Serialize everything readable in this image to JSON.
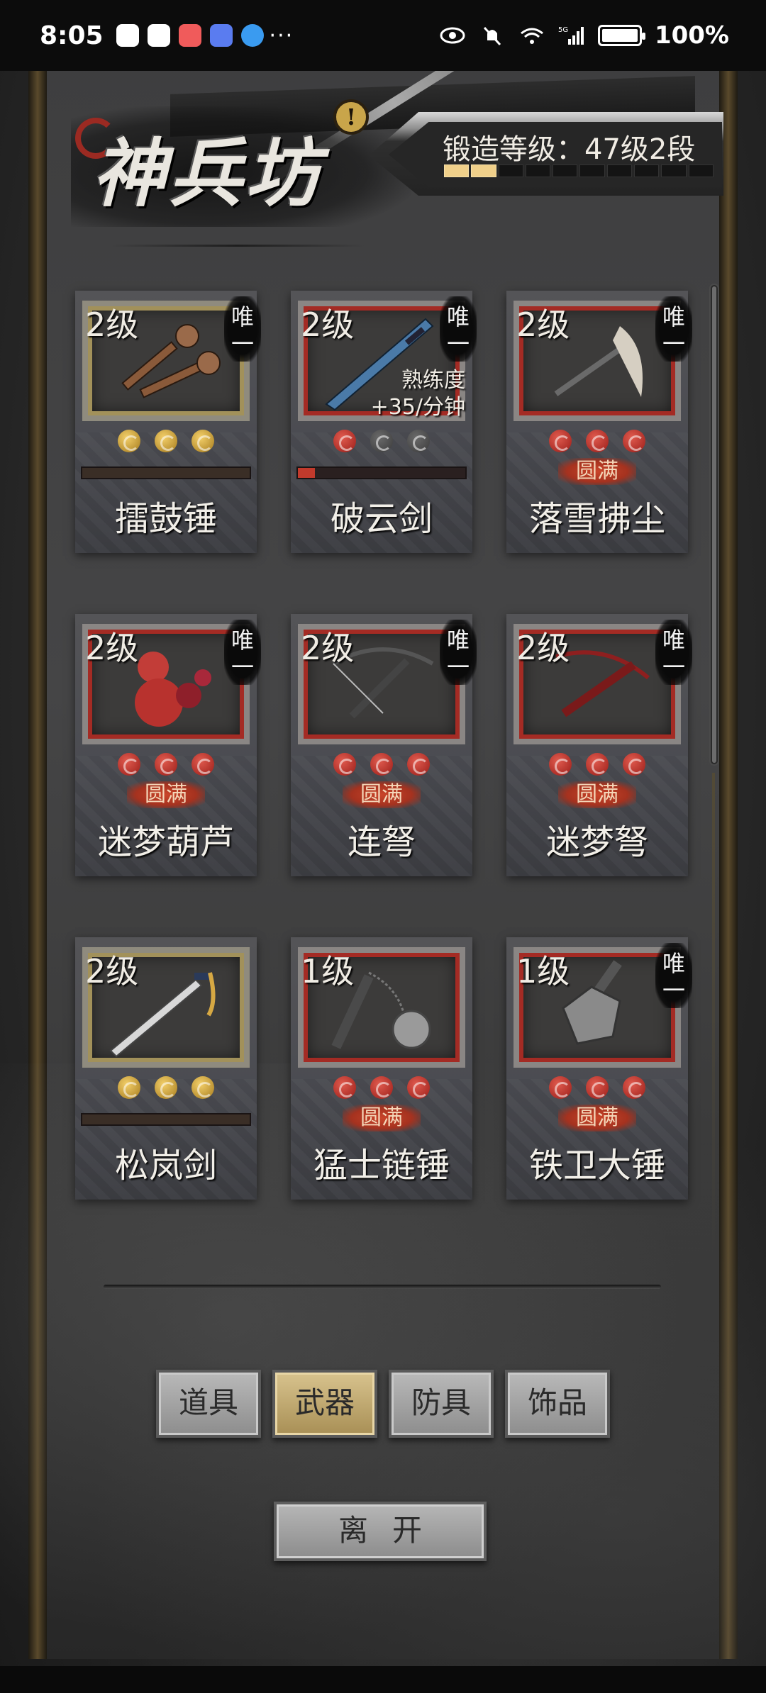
{
  "status_bar": {
    "time": "8:05",
    "more": "···",
    "battery_pct": "100%",
    "network": "5G"
  },
  "header": {
    "title": "神兵坊",
    "info_icon": "!",
    "forge_label": "锻造等级：47级2段",
    "forge_progress": {
      "filled": 2,
      "total": 10
    }
  },
  "weapons": [
    {
      "level": "2级",
      "unique": "唯一",
      "name": "擂鼓锤",
      "gems": [
        "gold",
        "gold",
        "gold"
      ],
      "frame": "gold",
      "status": "bar",
      "bar_fill": 0.0,
      "icon": "twin-hammers-icon"
    },
    {
      "level": "2级",
      "unique": "唯一",
      "name": "破云剑",
      "gems": [
        "red",
        "grey",
        "grey"
      ],
      "frame": "red",
      "status": "bar",
      "bar_fill": 0.1,
      "mastery": "熟练度",
      "rate": "+35/分钟",
      "icon": "blue-sword-icon"
    },
    {
      "level": "2级",
      "unique": "唯一",
      "name": "落雪拂尘",
      "gems": [
        "red",
        "red",
        "red"
      ],
      "frame": "red",
      "status": "full",
      "badge": "圆满",
      "icon": "whisk-icon"
    },
    {
      "level": "2级",
      "unique": "唯一",
      "name": "迷梦葫芦",
      "gems": [
        "red",
        "red",
        "red"
      ],
      "frame": "red",
      "status": "full",
      "badge": "圆满",
      "icon": "gourd-icon"
    },
    {
      "level": "2级",
      "unique": "唯一",
      "name": "连弩",
      "gems": [
        "red",
        "red",
        "red"
      ],
      "frame": "red",
      "status": "full",
      "badge": "圆满",
      "icon": "crossbow-icon"
    },
    {
      "level": "2级",
      "unique": "唯一",
      "name": "迷梦弩",
      "gems": [
        "red",
        "red",
        "red"
      ],
      "frame": "red",
      "status": "full",
      "badge": "圆满",
      "icon": "red-crossbow-icon"
    },
    {
      "level": "2级",
      "unique": "",
      "name": "松岚剑",
      "gems": [
        "gold",
        "gold",
        "gold"
      ],
      "frame": "gold",
      "status": "bar",
      "bar_fill": 0.0,
      "icon": "tassel-sword-icon"
    },
    {
      "level": "1级",
      "unique": "",
      "name": "猛士链锤",
      "gems": [
        "red",
        "red",
        "red"
      ],
      "frame": "red",
      "status": "full",
      "badge": "圆满",
      "icon": "flail-icon"
    },
    {
      "level": "1级",
      "unique": "唯一",
      "name": "铁卫大锤",
      "gems": [
        "red",
        "red",
        "red"
      ],
      "frame": "red",
      "status": "full",
      "badge": "圆满",
      "icon": "great-hammer-icon"
    }
  ],
  "tabs": [
    {
      "label": "道具",
      "active": false
    },
    {
      "label": "武器",
      "active": true
    },
    {
      "label": "防具",
      "active": false
    },
    {
      "label": "饰品",
      "active": false
    }
  ],
  "leave_button": "离开",
  "colors": {
    "gem_red": "#b3261e",
    "gem_gold": "#d4a534",
    "badge_red": "#b8391f",
    "active_tab": "#c8b07a"
  }
}
